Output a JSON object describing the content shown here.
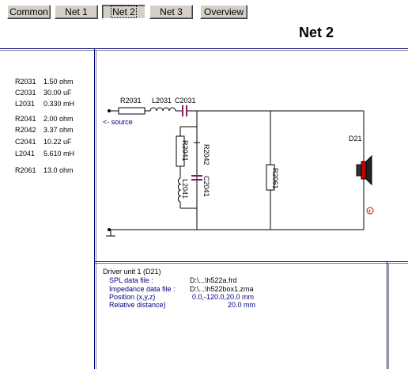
{
  "tabs": [
    {
      "label": "Common",
      "active": false
    },
    {
      "label": "Net 1",
      "active": false
    },
    {
      "label": "Net 2",
      "active": true
    },
    {
      "label": "Net 3",
      "active": false
    },
    {
      "label": "Overview",
      "active": false
    }
  ],
  "net_title": "Net 2",
  "components": [
    {
      "name": "R2031",
      "value": "1.50 ohm"
    },
    {
      "name": "C2031",
      "value": "30.00 uF"
    },
    {
      "name": "L2031",
      "value": "0.330 mH"
    },
    {
      "name": "R2041",
      "value": "2.00 ohm"
    },
    {
      "name": "R2042",
      "value": "3.37 ohm"
    },
    {
      "name": "C2041",
      "value": "10.22 uF"
    },
    {
      "name": "L2041",
      "value": "5.610 mH"
    },
    {
      "name": "R2061",
      "value": "13.0 ohm"
    }
  ],
  "schematic": {
    "labels": {
      "r2031": "R2031",
      "l2031": "L2031",
      "c2031": "C2031",
      "source": "<- source",
      "r2041": "R2041",
      "r2042": "R2042",
      "l2041": "L2041",
      "c2041": "C2041",
      "r2061": "R2061",
      "driver": "D21",
      "polarity": "+"
    }
  },
  "driver_info": {
    "header": "Driver unit 1 (D21)",
    "spl_label": "SPL data file :",
    "spl_value": "D:\\...\\h522a.frd",
    "imp_label": "Impedance data file :",
    "imp_value": "D:\\...\\h522box1.zma",
    "pos_label": "Position (x,y,z)",
    "pos_value": "0.0,-120.0,20.0 mm",
    "rel_label": "Relative distance)",
    "rel_value": "20.0 mm"
  },
  "colors": {
    "divider": "#000080",
    "capacitor": "#8b1a5a",
    "speaker_red": "#cc0000",
    "button_face": "#d4d0c8"
  }
}
